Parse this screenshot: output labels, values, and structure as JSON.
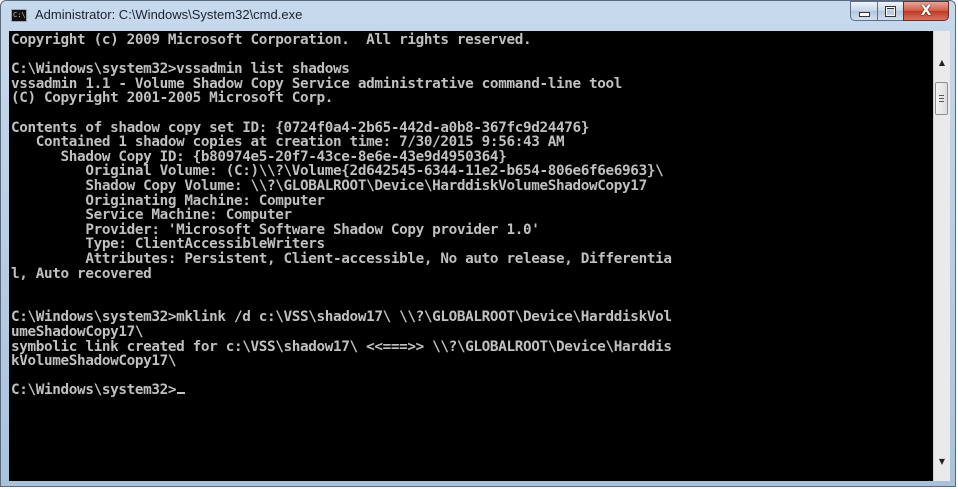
{
  "window": {
    "title": "Administrator: C:\\Windows\\System32\\cmd.exe",
    "icon": "cmd-icon",
    "icon_text": "C:\\."
  },
  "controls": {
    "minimize": "minimize-icon",
    "maximize": "maximize-icon",
    "close": "close-icon",
    "close_glyph": "X"
  },
  "console_lines": [
    "Copyright (c) 2009 Microsoft Corporation.  All rights reserved.",
    "",
    "C:\\Windows\\system32>vssadmin list shadows",
    "vssadmin 1.1 - Volume Shadow Copy Service administrative command-line tool",
    "(C) Copyright 2001-2005 Microsoft Corp.",
    "",
    "Contents of shadow copy set ID: {0724f0a4-2b65-442d-a0b8-367fc9d24476}",
    "   Contained 1 shadow copies at creation time: 7/30/2015 9:56:43 AM",
    "      Shadow Copy ID: {b80974e5-20f7-43ce-8e6e-43e9d4950364}",
    "         Original Volume: (C:)\\\\?\\Volume{2d642545-6344-11e2-b654-806e6f6e6963}\\",
    "         Shadow Copy Volume: \\\\?\\GLOBALROOT\\Device\\HarddiskVolumeShadowCopy17",
    "         Originating Machine: Computer",
    "         Service Machine: Computer",
    "         Provider: 'Microsoft Software Shadow Copy provider 1.0'",
    "         Type: ClientAccessibleWriters",
    "         Attributes: Persistent, Client-accessible, No auto release, Differentia",
    "l, Auto recovered",
    "",
    "",
    "C:\\Windows\\system32>mklink /d c:\\VSS\\shadow17\\ \\\\?\\GLOBALROOT\\Device\\HarddiskVol",
    "umeShadowCopy17\\",
    "symbolic link created for c:\\VSS\\shadow17\\ <<===>> \\\\?\\GLOBALROOT\\Device\\Harddis",
    "kVolumeShadowCopy17\\",
    "",
    "C:\\Windows\\system32>"
  ],
  "colors": {
    "console_bg": "#000000",
    "console_fg": "#c0c0c0",
    "close_red": "#c03a25"
  },
  "scrollbar": {
    "up": "scroll-up-arrow-icon",
    "down": "scroll-down-arrow-icon",
    "up_glyph": "▲",
    "down_glyph": "▼"
  }
}
